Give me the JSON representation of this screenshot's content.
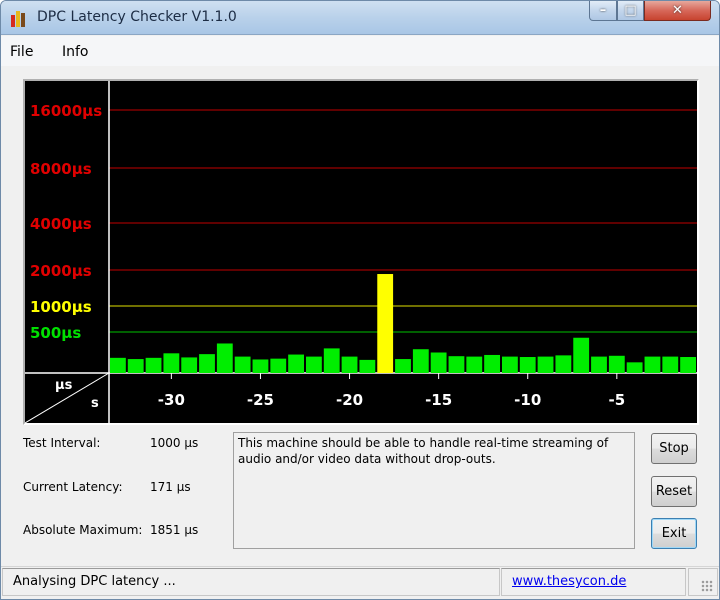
{
  "window": {
    "title": "DPC Latency Checker V1.1.0",
    "minimize": "–",
    "maximize": "□",
    "close": "✕"
  },
  "menu": {
    "items": [
      "File",
      "Info"
    ]
  },
  "chart_data": {
    "type": "bar",
    "y_scale": "log-bands",
    "y_ticks": [
      {
        "label": "16000µs",
        "value": 16000,
        "color": "#e00000"
      },
      {
        "label": "8000µs",
        "value": 8000,
        "color": "#e00000"
      },
      {
        "label": "4000µs",
        "value": 4000,
        "color": "#e00000"
      },
      {
        "label": "2000µs",
        "value": 2000,
        "color": "#e00000"
      },
      {
        "label": "1000µs",
        "value": 1000,
        "color": "#ffff00"
      },
      {
        "label": "500µs",
        "value": 500,
        "color": "#00e000"
      }
    ],
    "x_ticks": [
      -30,
      -25,
      -20,
      -15,
      -10,
      -5
    ],
    "x_tick_labels": [
      "-30",
      "-25",
      "-20",
      "-15",
      "-10",
      "-5"
    ],
    "corner_y_unit": "µs",
    "corner_x_unit": "s",
    "x": [
      -33,
      -32,
      -31,
      -30,
      -29,
      -28,
      -27,
      -26,
      -25,
      -24,
      -23,
      -22,
      -21,
      -20,
      -19,
      -18,
      -17,
      -16,
      -15,
      -14,
      -13,
      -12,
      -11,
      -10,
      -9,
      -8,
      -7,
      -6,
      -5,
      -4,
      -3,
      -2,
      -1
    ],
    "values_us": [
      185,
      170,
      185,
      240,
      190,
      230,
      360,
      200,
      165,
      175,
      225,
      200,
      300,
      200,
      160,
      1851,
      170,
      290,
      250,
      205,
      200,
      220,
      200,
      195,
      200,
      215,
      430,
      200,
      210,
      130,
      200,
      200,
      195
    ],
    "bar_colors": {
      "normal": "#00ee00",
      "warning": "#ffff00"
    }
  },
  "info": {
    "test_interval_label": "Test Interval:",
    "test_interval_value": "1000 µs",
    "current_latency_label": "Current Latency:",
    "current_latency_value": "171 µs",
    "absolute_maximum_label": "Absolute Maximum:",
    "absolute_maximum_value": "1851 µs"
  },
  "message": "This machine should be able to handle real-time streaming of audio and/or video data without drop-outs.",
  "buttons": {
    "stop": "Stop",
    "reset": "Reset",
    "exit": "Exit"
  },
  "status": {
    "text": "Analysing DPC latency ...",
    "link": "www.thesycon.de"
  }
}
